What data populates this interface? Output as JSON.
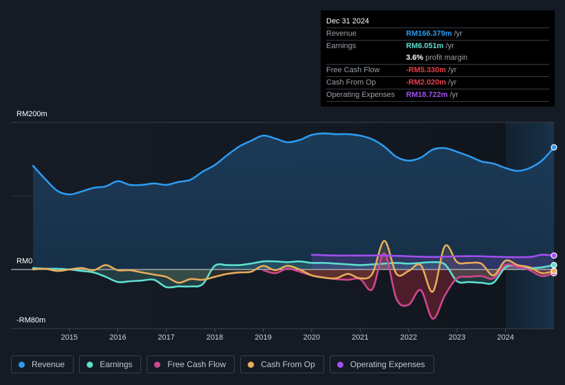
{
  "tooltip": {
    "date": "Dec 31 2024",
    "rows": [
      {
        "label": "Revenue",
        "value": "RM166.379m",
        "unit": " /yr",
        "color": "#2d9bf0"
      },
      {
        "label": "Earnings",
        "value": "RM6.051m",
        "unit": " /yr",
        "color": "#5ee0cf"
      },
      {
        "label": "",
        "value": "3.6%",
        "unit": " profit margin",
        "color": "#ffffff"
      },
      {
        "label": "Free Cash Flow",
        "value": "-RM5.330m",
        "unit": " /yr",
        "color": "#e8404a"
      },
      {
        "label": "Cash From Op",
        "value": "-RM2.020m",
        "unit": " /yr",
        "color": "#e8404a"
      },
      {
        "label": "Operating Expenses",
        "value": "RM18.722m",
        "unit": " /yr",
        "color": "#a24ff0"
      }
    ]
  },
  "legend": [
    {
      "label": "Revenue",
      "color": "#2d9bf0"
    },
    {
      "label": "Earnings",
      "color": "#5ee0cf"
    },
    {
      "label": "Free Cash Flow",
      "color": "#d0478f"
    },
    {
      "label": "Cash From Op",
      "color": "#e8ad5a"
    },
    {
      "label": "Operating Expenses",
      "color": "#a24ff0"
    }
  ],
  "chart_data": {
    "type": "line",
    "title": "",
    "xlabel": "",
    "ylabel": "",
    "y_tick_labels": [
      "RM200m",
      "RM0",
      "-RM80m"
    ],
    "x_tick_labels": [
      "2015",
      "2016",
      "2017",
      "2018",
      "2019",
      "2020",
      "2021",
      "2022",
      "2023",
      "2024"
    ],
    "xlim": [
      2014.25,
      2025.0
    ],
    "ylim": [
      -80,
      200
    ],
    "grid": true,
    "highlight_from": 2024.0,
    "series": [
      {
        "name": "Revenue",
        "color": "#2d9bf0",
        "x": [
          2014.25,
          2014.5,
          2014.75,
          2015.0,
          2015.25,
          2015.5,
          2015.75,
          2016.0,
          2016.25,
          2016.5,
          2016.75,
          2017.0,
          2017.25,
          2017.5,
          2017.75,
          2018.0,
          2018.25,
          2018.5,
          2018.75,
          2019.0,
          2019.25,
          2019.5,
          2019.75,
          2020.0,
          2020.25,
          2020.5,
          2020.75,
          2021.0,
          2021.25,
          2021.5,
          2021.75,
          2022.0,
          2022.25,
          2022.5,
          2022.75,
          2023.0,
          2023.25,
          2023.5,
          2023.75,
          2024.0,
          2024.25,
          2024.5,
          2024.75,
          2025.0
        ],
        "values": [
          141,
          123,
          107,
          102,
          106,
          111,
          113,
          120,
          115,
          115,
          117,
          115,
          119,
          122,
          133,
          142,
          155,
          167,
          175,
          182,
          178,
          173,
          176,
          183,
          185,
          184,
          184,
          182,
          177,
          167,
          153,
          148,
          152,
          163,
          165,
          160,
          154,
          147,
          144,
          138,
          134,
          138,
          148,
          166
        ]
      },
      {
        "name": "Earnings",
        "color": "#5ee0cf",
        "x": [
          2014.25,
          2014.5,
          2014.75,
          2015.0,
          2015.25,
          2015.5,
          2015.75,
          2016.0,
          2016.25,
          2016.5,
          2016.75,
          2017.0,
          2017.25,
          2017.5,
          2017.75,
          2018.0,
          2018.25,
          2018.5,
          2018.75,
          2019.0,
          2019.25,
          2019.5,
          2019.75,
          2020.0,
          2020.25,
          2020.5,
          2020.75,
          2021.0,
          2021.25,
          2021.5,
          2021.75,
          2022.0,
          2022.25,
          2022.5,
          2022.75,
          2023.0,
          2023.25,
          2023.5,
          2023.75,
          2024.0,
          2024.25,
          2024.5,
          2024.75,
          2025.0
        ],
        "values": [
          2,
          1,
          1,
          0,
          -2,
          -4,
          -10,
          -17,
          -16,
          -15,
          -14,
          -24,
          -23,
          -23,
          -20,
          5,
          6,
          6,
          8,
          11,
          11,
          10,
          11,
          9,
          9,
          8,
          7,
          6,
          7,
          8,
          9,
          8,
          9,
          10,
          7,
          -16,
          -17,
          -18,
          -18,
          3,
          5,
          2,
          3,
          6
        ]
      },
      {
        "name": "Free Cash Flow",
        "color": "#d0478f",
        "x": [
          2019.0,
          2019.25,
          2019.5,
          2019.75,
          2020.0,
          2020.25,
          2020.5,
          2020.75,
          2021.0,
          2021.25,
          2021.5,
          2021.75,
          2022.0,
          2022.25,
          2022.5,
          2022.75,
          2023.0,
          2023.25,
          2023.5,
          2023.75,
          2024.0,
          2024.25,
          2024.5,
          2024.75,
          2025.0
        ],
        "values": [
          -1,
          -5,
          1,
          -3,
          -8,
          -11,
          -13,
          -14,
          -13,
          -27,
          22,
          -40,
          -48,
          -28,
          -67,
          -35,
          -12,
          -10,
          -9,
          -12,
          6,
          4,
          -1,
          -9,
          -5
        ]
      },
      {
        "name": "Cash From Op",
        "color": "#e8ad5a",
        "x": [
          2014.25,
          2014.5,
          2014.75,
          2015.0,
          2015.25,
          2015.5,
          2015.75,
          2016.0,
          2016.25,
          2016.5,
          2016.75,
          2017.0,
          2017.25,
          2017.5,
          2017.75,
          2018.0,
          2018.25,
          2018.5,
          2018.75,
          2019.0,
          2019.25,
          2019.5,
          2019.75,
          2020.0,
          2020.25,
          2020.5,
          2020.75,
          2021.0,
          2021.25,
          2021.5,
          2021.75,
          2022.0,
          2022.25,
          2022.5,
          2022.75,
          2023.0,
          2023.25,
          2023.5,
          2023.75,
          2024.0,
          2024.25,
          2024.5,
          2024.75,
          2025.0
        ],
        "values": [
          0,
          1,
          -2,
          0,
          2,
          -1,
          6,
          -1,
          -1,
          -4,
          -7,
          -10,
          -18,
          -13,
          -14,
          -10,
          -6,
          -4,
          -3,
          5,
          -1,
          5,
          0,
          -8,
          -11,
          -12,
          -6,
          -12,
          -6,
          39,
          -6,
          -2,
          6,
          -30,
          32,
          10,
          9,
          8,
          -8,
          12,
          6,
          3,
          -5,
          -2
        ]
      },
      {
        "name": "Operating Expenses",
        "color": "#a24ff0",
        "x": [
          2020.0,
          2020.5,
          2021.0,
          2021.5,
          2022.0,
          2022.5,
          2023.0,
          2023.5,
          2024.0,
          2024.5,
          2024.75,
          2025.0
        ],
        "values": [
          20,
          19,
          19,
          19,
          18,
          17,
          18,
          18,
          17,
          17,
          20,
          19
        ]
      }
    ]
  }
}
